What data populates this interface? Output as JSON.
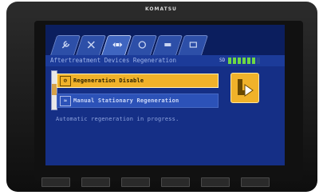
{
  "brand": "KOMATSU",
  "tabs": [
    {
      "icon": "wrench-icon",
      "active": false
    },
    {
      "icon": "tools-icon",
      "active": false
    },
    {
      "icon": "engine-arrows-icon",
      "active": true
    },
    {
      "icon": "filter-icon",
      "active": false
    },
    {
      "icon": "gear-icon",
      "active": false
    },
    {
      "icon": "monitor-icon",
      "active": false
    }
  ],
  "header": {
    "title": "Aftertreatment Devices Regeneration",
    "gauge_label": "SD",
    "gauge_level": 6,
    "gauge_max": 7
  },
  "menu": {
    "items": [
      {
        "label": "Regeneration Disable",
        "selected": true
      },
      {
        "label": "Manual Stationary Regeneration",
        "selected": false
      }
    ]
  },
  "message": "Automatic regeneration in progress.",
  "softkeys": [
    "back-arrow-icon",
    "forward-arrow-icon",
    "return-icon",
    "check-icon"
  ],
  "colors": {
    "screen_bg": "#152f86",
    "selected": "#f0b22a",
    "gauge_on": "#6fd844"
  }
}
